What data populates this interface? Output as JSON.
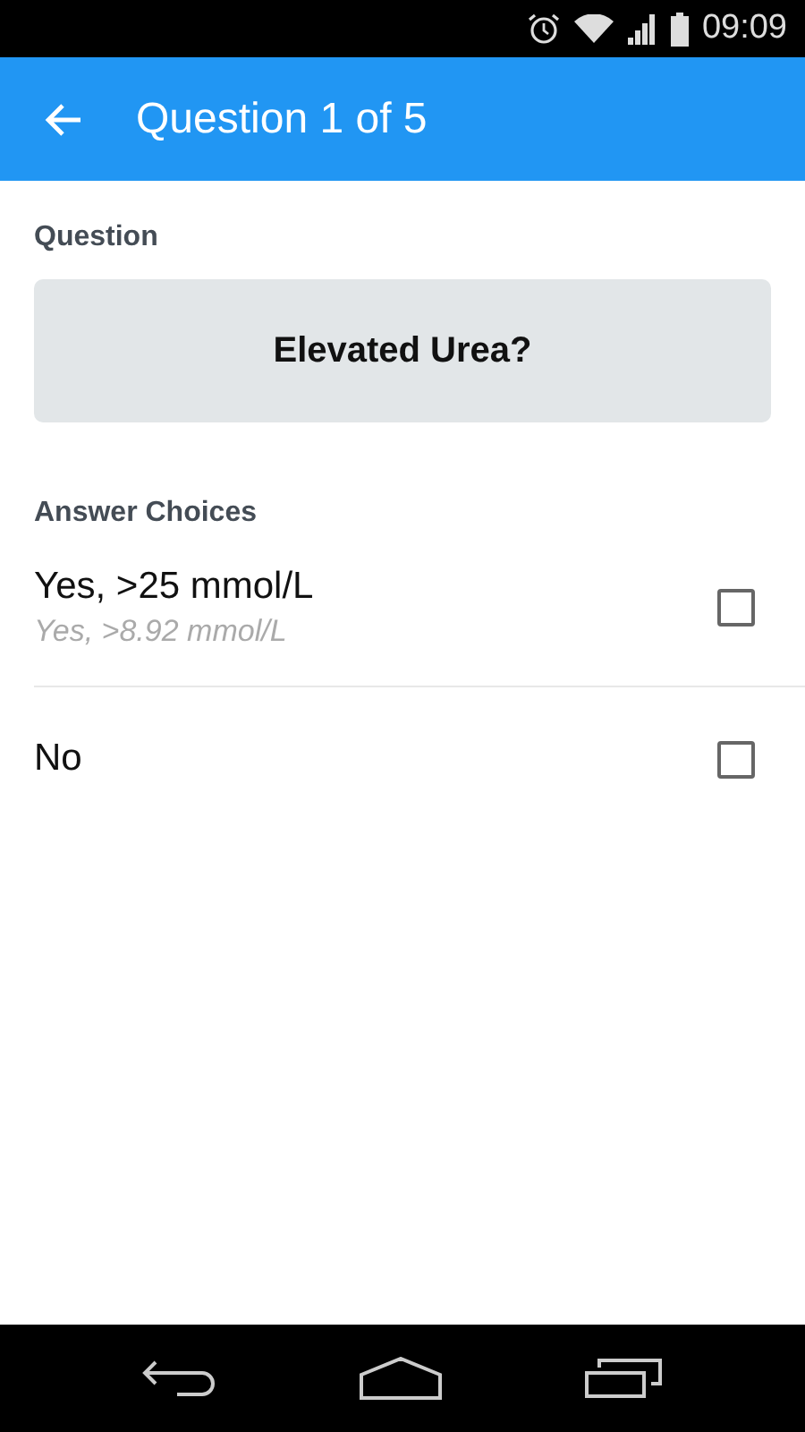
{
  "status_bar": {
    "time": "09:09"
  },
  "app_bar": {
    "title": "Question 1 of 5"
  },
  "question": {
    "label": "Question",
    "text": "Elevated Urea?"
  },
  "answers": {
    "label": "Answer Choices",
    "choices": [
      {
        "text": "Yes, >25 mmol/L",
        "subtext": "Yes, >8.92 mmol/L",
        "checked": false
      },
      {
        "text": "No",
        "checked": false
      }
    ]
  }
}
